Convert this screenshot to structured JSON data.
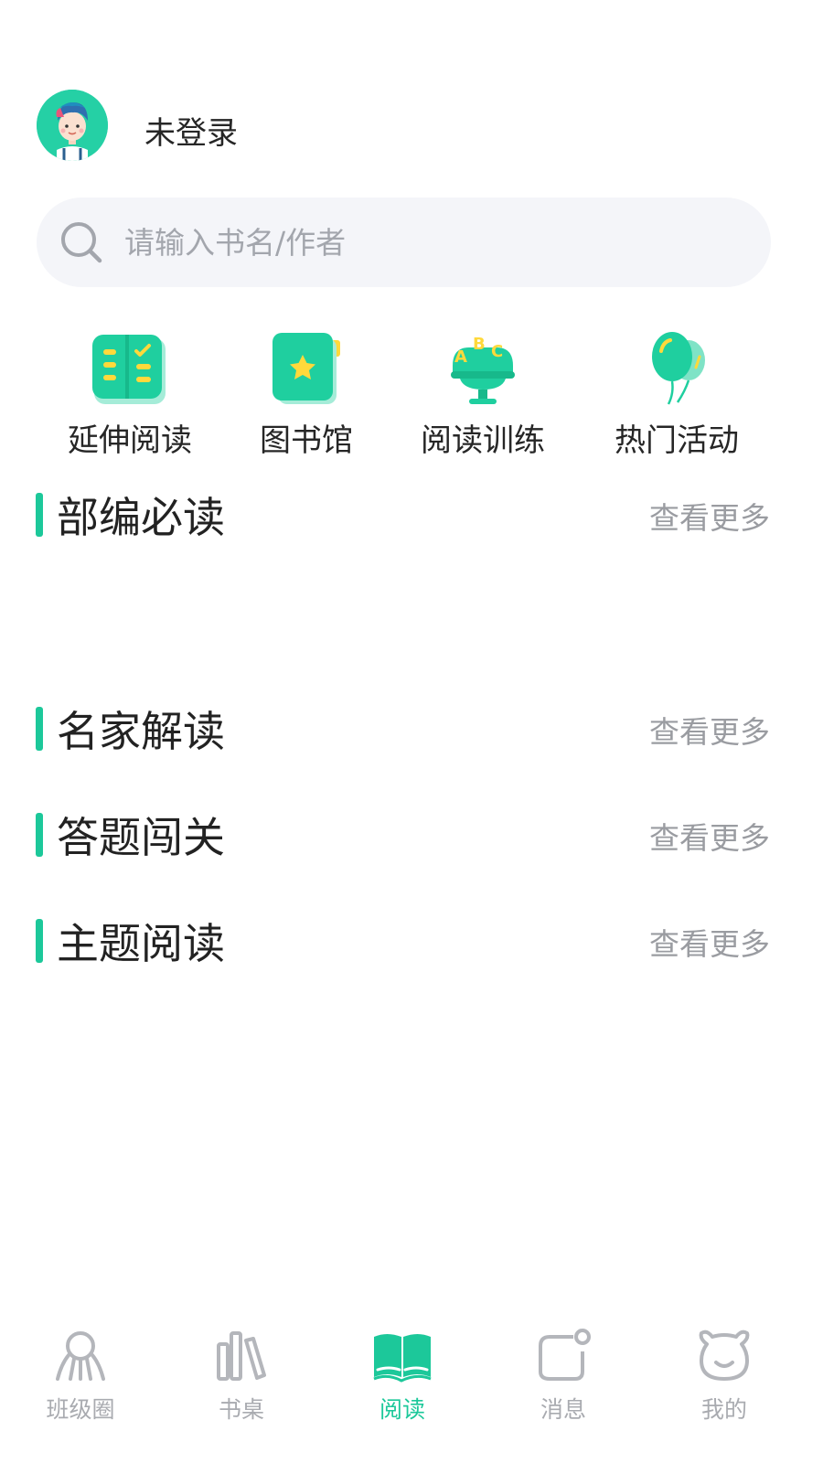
{
  "header": {
    "login_label": "未登录"
  },
  "search": {
    "placeholder": "请输入书名/作者"
  },
  "quick_links": [
    {
      "label": "延伸阅读",
      "icon": "checklist-book-icon"
    },
    {
      "label": "图书馆",
      "icon": "star-book-icon"
    },
    {
      "label": "阅读训练",
      "icon": "abc-microphone-icon"
    },
    {
      "label": "热门活动",
      "icon": "balloons-icon"
    }
  ],
  "sections": [
    {
      "title": "部编必读",
      "more": "查看更多"
    },
    {
      "title": "名家解读",
      "more": "查看更多"
    },
    {
      "title": "答题闯关",
      "more": "查看更多"
    },
    {
      "title": "主题阅读",
      "more": "查看更多"
    }
  ],
  "tabbar": {
    "active_index": 2,
    "items": [
      {
        "label": "班级圈",
        "icon": "class-circle-icon"
      },
      {
        "label": "书桌",
        "icon": "books-icon"
      },
      {
        "label": "阅读",
        "icon": "open-book-icon"
      },
      {
        "label": "消息",
        "icon": "message-icon"
      },
      {
        "label": "我的",
        "icon": "bear-face-icon"
      }
    ]
  },
  "colors": {
    "accent": "#1cc89a",
    "muted_text": "#9a9ca1",
    "search_bg": "#f4f5f9",
    "inactive_tab": "#a9abb0"
  }
}
